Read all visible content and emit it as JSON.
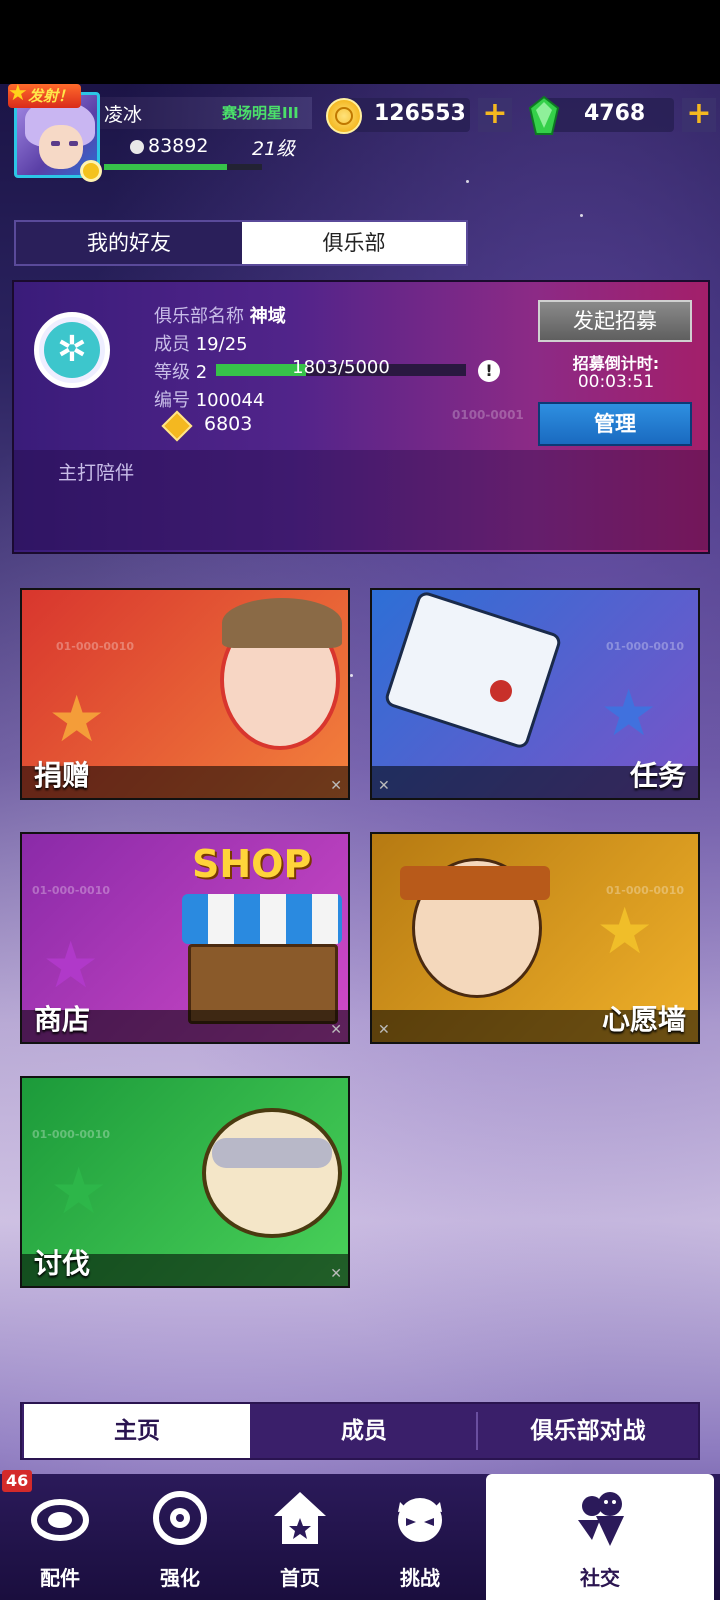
{
  "header": {
    "badge": "发射！",
    "player_name": "凌冰",
    "rank": "赛场明星III",
    "power": "83892",
    "level": "21级",
    "xp_fraction": 0.78,
    "coins": "126553",
    "gems": "4768"
  },
  "top_tabs": [
    {
      "label": "我的好友",
      "active": false
    },
    {
      "label": "俱乐部",
      "active": true
    }
  ],
  "club": {
    "name_label": "俱乐部名称",
    "name_value": "神域",
    "members_label": "成员",
    "members_value": "19/25",
    "level_label": "等级",
    "level_value": "2",
    "xp_text": "1803/5000",
    "xp_fraction": 0.3606,
    "id_label": "编号",
    "id_value": "100044",
    "gold_value": "6803",
    "motto": "主打陪伴",
    "recruit_button": "发起招募",
    "countdown_label": "招募倒计时:",
    "countdown_value": "00:03:51",
    "manage_button": "管理",
    "deco_code": "0100-0001"
  },
  "cards": [
    {
      "label": "捐赠",
      "colors": [
        "#d8362e",
        "#f3813c"
      ],
      "star_color": "#f7a63a"
    },
    {
      "label": "任务",
      "colors": [
        "#2d6fd6",
        "#7a54c8"
      ],
      "star_color": "#3d74e0"
    },
    {
      "label": "商店",
      "colors": [
        "#8a2aa8",
        "#d04ac8"
      ],
      "star_color": "#b23acc"
    },
    {
      "label": "心愿墙",
      "colors": [
        "#b67a12",
        "#f0b12a"
      ],
      "star_color": "#f3c22a"
    },
    {
      "label": "讨伐",
      "colors": [
        "#1c9a3a",
        "#4ad25a"
      ],
      "star_color": "#2eb84a"
    }
  ],
  "shop_sign": "SHOP",
  "card_code": "01-000-0010",
  "sub_tabs": [
    {
      "label": "主页",
      "active": true
    },
    {
      "label": "成员",
      "active": false
    },
    {
      "label": "俱乐部对战",
      "active": false
    }
  ],
  "nav": {
    "badge": "46",
    "items": [
      {
        "label": "配件",
        "icon": "parts-icon",
        "active": false
      },
      {
        "label": "强化",
        "icon": "upgrade-icon",
        "active": false
      },
      {
        "label": "首页",
        "icon": "home-icon",
        "active": false
      },
      {
        "label": "挑战",
        "icon": "challenge-icon",
        "active": false
      },
      {
        "label": "社交",
        "icon": "social-icon",
        "active": true
      }
    ]
  }
}
